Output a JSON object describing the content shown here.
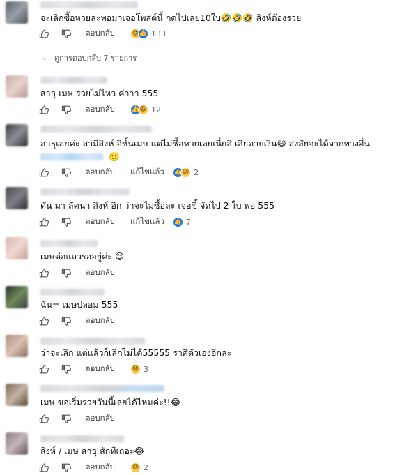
{
  "comments": [
    {
      "text": "จะเลิกซื้อหวยละพอมาเจอโพสต์นี้ กดไปเลย10ใบ🤣🤣🤣 สิงห์ต้องรวย",
      "reply_label": "ตอบกลับ",
      "edited_label": "",
      "reactions": [
        "haha",
        "like"
      ],
      "count": "133"
    },
    {
      "text": "สาธุ เมษ รวยไม่ไหว ค่าาา 555",
      "reply_label": "ตอบกลับ",
      "edited_label": "",
      "reactions": [
        "like",
        "haha"
      ],
      "count": "12"
    },
    {
      "text": "สาธุเลยค่ะ สามีสิงห์ อีชั้นเมษ แต่ไม่ซื้อหวยเลยเนี่ยสิ เสียดายเงิน😄 สงสัยจะได้จากทางอื่น",
      "text2": "🙁",
      "reply_label": "ตอบกลับ",
      "edited_label": "แก้ไขแล้ว",
      "reactions": [
        "like",
        "haha"
      ],
      "count": "2"
    },
    {
      "text": "ดัน มา ลัคนา สิงห์ อิก ว่าจะไม่ซื้อละ เจอขี้ จัดไป 2 ใบ พอ 555",
      "reply_label": "ตอบกลับ",
      "edited_label": "แก้ไขแล้ว",
      "reactions": [
        "like"
      ],
      "count": "7"
    },
    {
      "text": "เมษต่อแถวรออยู่ค่ะ 😊",
      "reply_label": "ตอบกลับ",
      "edited_label": "",
      "reactions": [],
      "count": ""
    },
    {
      "text": "ฉัน= เมษปลอม 555",
      "reply_label": "ตอบกลับ",
      "edited_label": "",
      "reactions": [],
      "count": ""
    },
    {
      "text": "ว่าจะเลิก แต่แล้วก็เลิกไม่ได้55555 ราศีตัวเองอีกละ",
      "reply_label": "ตอบกลับ",
      "edited_label": "",
      "reactions": [
        "haha"
      ],
      "count": "3"
    },
    {
      "text": "เมษ ขอเริ่มรวยวันนี้เลยได้ไหมค่ะ!!😂",
      "reply_label": "ตอบกลับ",
      "edited_label": "",
      "reactions": [],
      "count": ""
    },
    {
      "text": "สิงห์ / เมษ สาธุ สักทีเถอะ😂",
      "reply_label": "ตอบกลับ",
      "edited_label": "",
      "reactions": [
        "haha"
      ],
      "count": "2"
    }
  ],
  "view_replies": "ดูการตอบกลับ 7 รายการ",
  "icons": {
    "like": "thumbs-up-icon",
    "dislike": "thumbs-down-icon",
    "expand": "chevron-down-icon"
  },
  "colors": {
    "like_blue": "#1877f2",
    "haha_yellow": "#f7c948",
    "secondary_text": "#65676b"
  }
}
